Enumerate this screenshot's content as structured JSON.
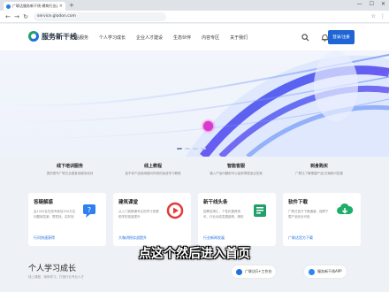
{
  "browser": {
    "tab_title": "广联达服务新干线-建筑行业云计...",
    "tab_close": "×",
    "new_tab": "+",
    "window_controls": [
      "—",
      "☐",
      "✕"
    ],
    "nav": [
      "←",
      "→",
      "↻"
    ],
    "url": "service.glodon.com"
  },
  "header": {
    "logo_text": "服务新干线",
    "nav_items": [
      "产品服务",
      "个人学习成长",
      "企业人才建设",
      "生态伙伴",
      "内容专区",
      "关于我们"
    ],
    "login_label": "登录/注册"
  },
  "banner": {
    "dots": 4,
    "active_dot": 0
  },
  "features": [
    {
      "title": "线下培训服务",
      "desc": "提供更专广联达全国各地服务培训"
    },
    {
      "title": "线上教程",
      "desc": "如不你产品使用疑问时我的免费学习教程"
    },
    {
      "title": "智能客服",
      "desc": "输入产品问题即可以高获得更适合答案"
    },
    {
      "title": "到身购买",
      "desc": "广联达了解便捷产品/方案和问答建"
    }
  ],
  "cards": [
    {
      "title": "答疑解惑",
      "desc": "由1000名在线专家及300万名问题库答案，帮您找，买好到",
      "link": "行问快速获得",
      "icon": "chat-bubble-icon",
      "color": "#2f7ff0"
    },
    {
      "title": "建筑课堂",
      "desc": "从入门到精通专业的学习资源助学的技能提升",
      "link": "大咖讲授实战提升",
      "icon": "play-circle-icon",
      "color": "#e23b3b"
    },
    {
      "title": "新干线头条",
      "desc": "招聘名闻汇，个性化推荐资讯，行业动态发展趋势，精彩",
      "link": "行业新闻发展",
      "icon": "news-icon",
      "color": "#22a06b"
    },
    {
      "title": "软件下载",
      "desc": "广联达官方下载通道，保障下载产品安全可信",
      "link": "广联达官方下载",
      "icon": "cloud-download-icon",
      "color": "#1fae6a"
    }
  ],
  "section": {
    "title": "个人学习成长",
    "subtitle": "线上课程、案例学习，打造行业专业人才"
  },
  "pills": [
    {
      "label": "广联达G+工作台",
      "color": "#1e6fe0"
    },
    {
      "label": "服务新干线APP",
      "color": "#2a86f0"
    }
  ],
  "overlay_caption": "点这个然后进入首页"
}
